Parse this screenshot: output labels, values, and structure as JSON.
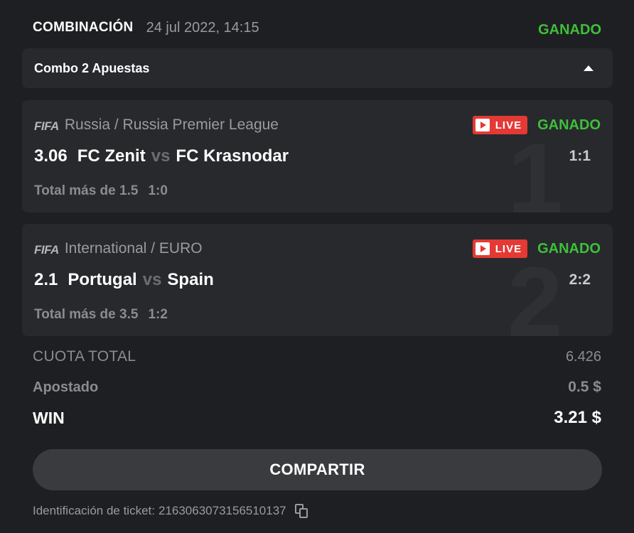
{
  "header": {
    "title": "COMBINACIÓN",
    "date": "24 jul 2022, 14:15",
    "status": "GANADO"
  },
  "combo": {
    "label": "Combo 2 Apuestas",
    "arrow_icon": "caret-up-icon"
  },
  "bets": [
    {
      "number": "1",
      "sport_logo": "FIFA",
      "league": "Russia / Russia Premier League",
      "live_label": "LIVE",
      "status": "GANADO",
      "odd": "3.06",
      "home": "FC Zenit",
      "vs": "vs",
      "away": "FC Krasnodar",
      "score": "1:1",
      "market": "Total más de 1.5",
      "market_score": "1:0"
    },
    {
      "number": "2",
      "sport_logo": "FIFA",
      "league": "International / EURO",
      "live_label": "LIVE",
      "status": "GANADO",
      "odd": "2.1",
      "home": "Portugal",
      "vs": "vs",
      "away": "Spain",
      "score": "2:2",
      "market": "Total más de 3.5",
      "market_score": "1:2"
    }
  ],
  "summary": {
    "total_odds_label": "CUOTA TOTAL",
    "total_odds_value": "6.426",
    "staked_label": "Apostado",
    "staked_value": "0.5 $",
    "win_label": "WIN",
    "win_value": "3.21 $"
  },
  "share_button": "COMPARTIR",
  "ticket": {
    "label": "Identificación de ticket:",
    "id": "2163063073156510137",
    "copy_icon": "copy-icon"
  },
  "colors": {
    "background": "#1e1f22",
    "card": "#28292d",
    "won": "#3ec03a",
    "live": "#e53935",
    "button": "#3a3b3f"
  }
}
